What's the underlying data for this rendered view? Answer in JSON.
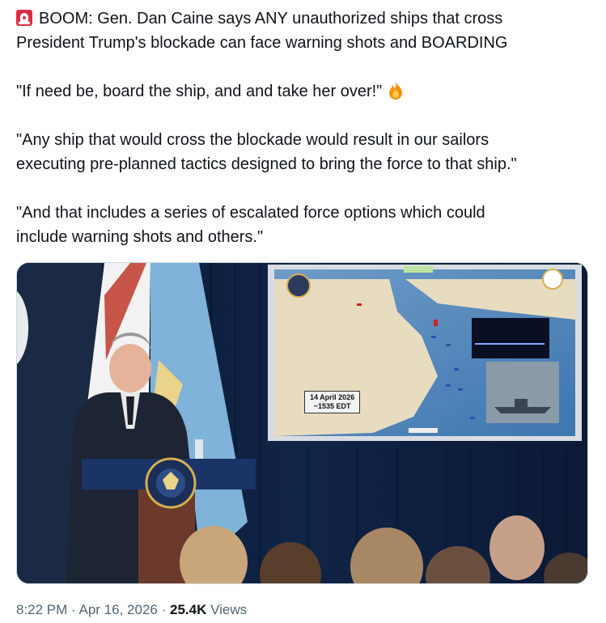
{
  "post": {
    "headline_line1": "BOOM: Gen. Dan Caine says ANY unauthorized ships that cross",
    "headline_line2": "President Trump's blockade can face warning shots and BOARDING",
    "quote1": "\"If need be, board the ship, and and take her over!\"",
    "quote2_line1": "\"Any ship that would cross the blockade would result in our sailors",
    "quote2_line2": "executing pre-planned tactics designed to bring the force to that ship.\"",
    "quote3_line1": "\"And that includes a series of escalated force options which could",
    "quote3_line2": "include warning shots and others.\""
  },
  "media": {
    "map_date": "14 April 2026",
    "map_time": "~1535 EDT"
  },
  "meta": {
    "time": "8:22 PM",
    "separator": "·",
    "date": "Apr 16, 2026",
    "views_count": "25.4K",
    "views_label": "Views"
  },
  "icons": {
    "siren": "siren-icon",
    "fire": "fire-icon"
  },
  "colors": {
    "text": "#0f1419",
    "meta": "#536471",
    "siren_red": "#e0245e",
    "fire_orange": "#f4900c"
  }
}
